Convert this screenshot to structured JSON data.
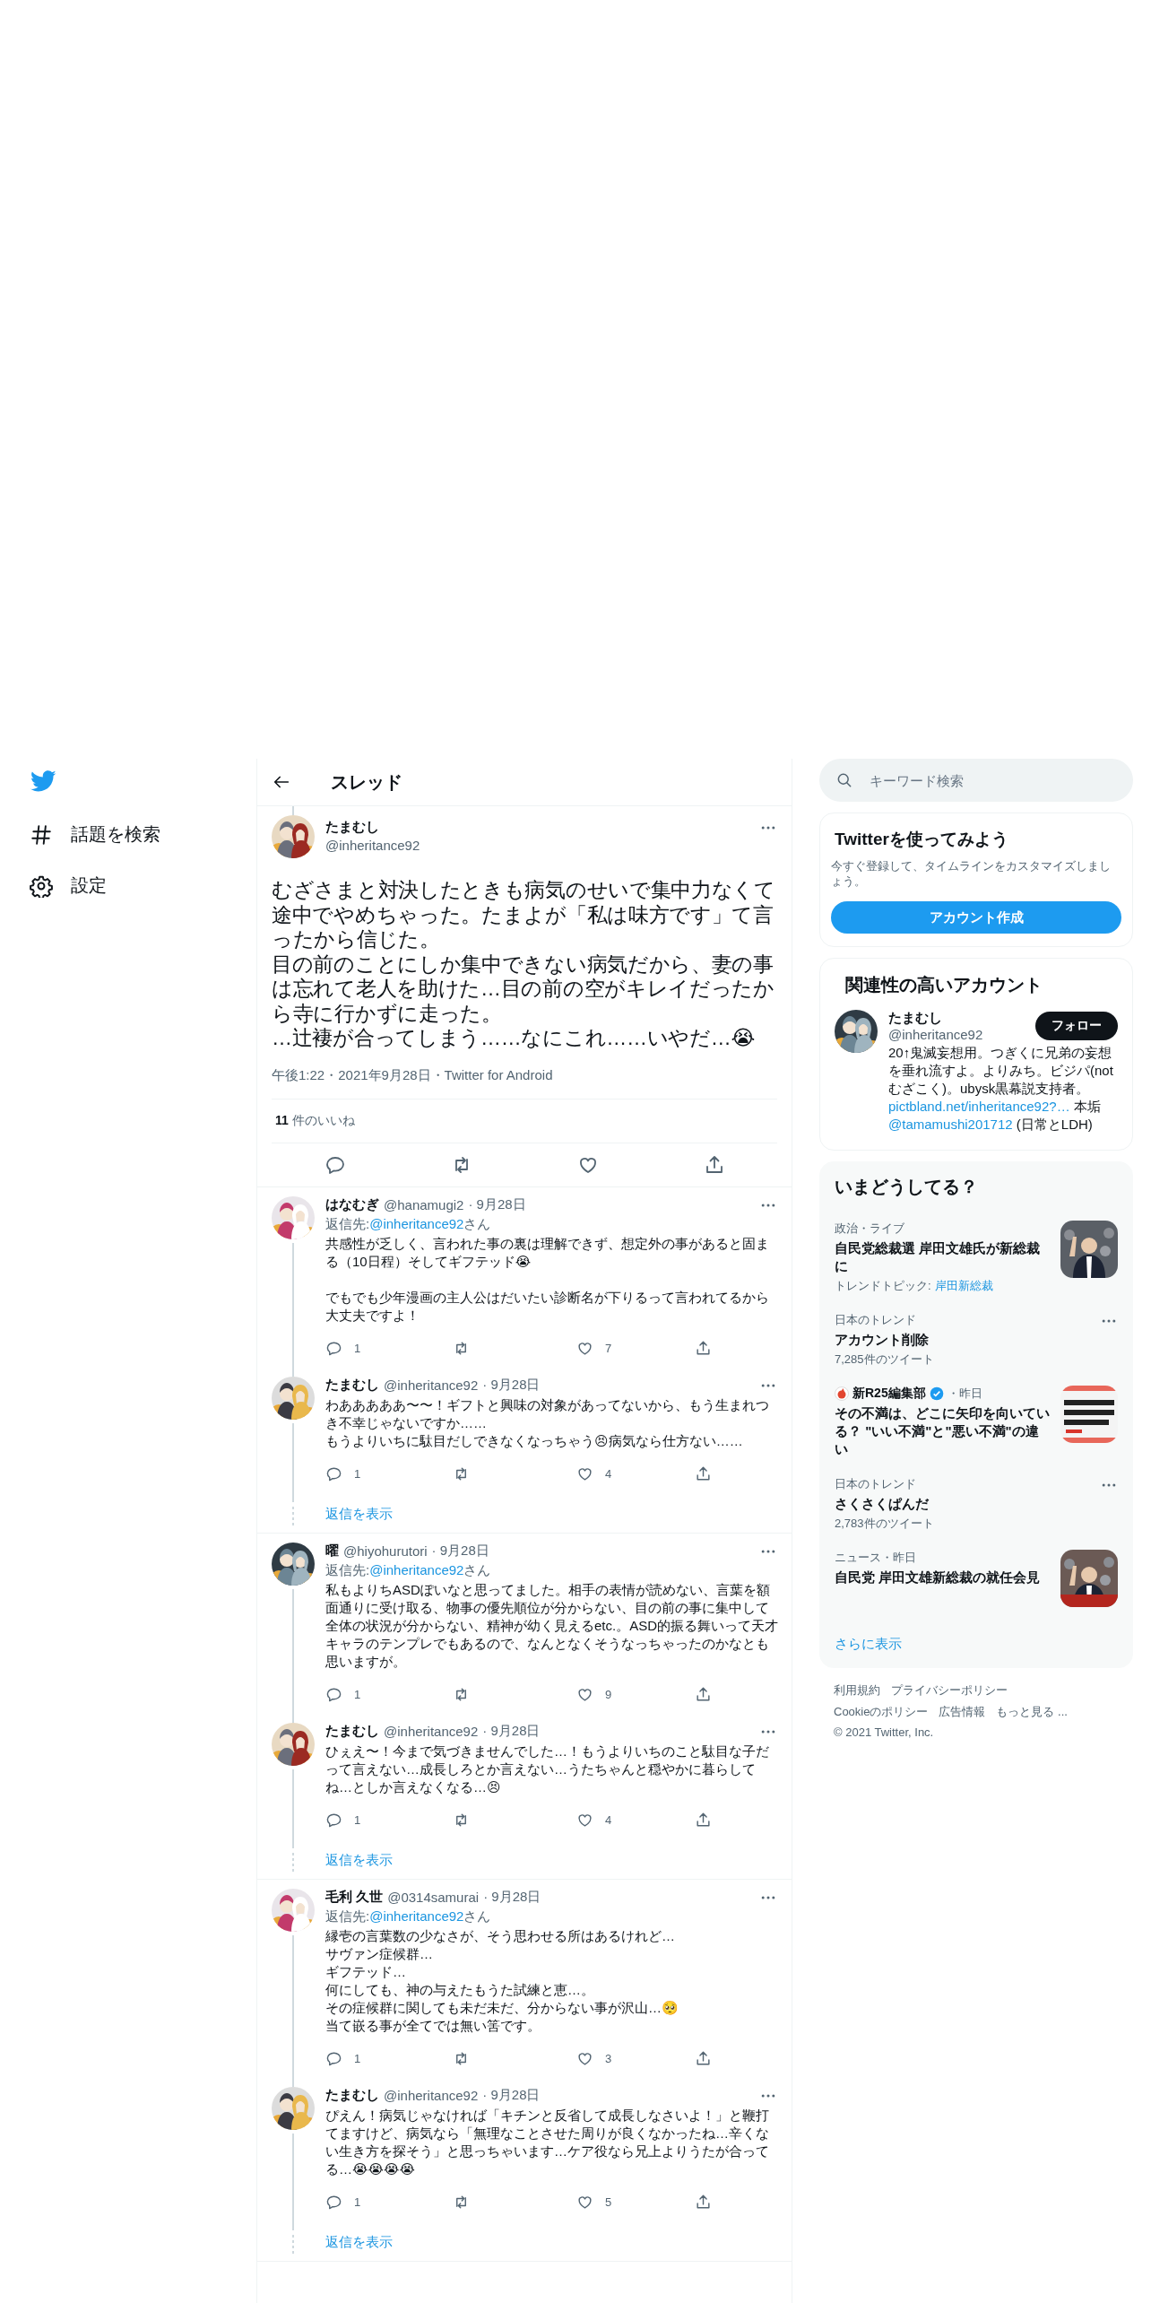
{
  "sidebar": {
    "items": [
      {
        "kind": "explore",
        "label": "話題を検索"
      },
      {
        "kind": "settings",
        "label": "設定"
      }
    ]
  },
  "header": {
    "title": "スレッド"
  },
  "main_tweet": {
    "name": "たまむし",
    "handle": "@inheritance92",
    "avatar": {
      "kind": "picture"
    },
    "body": [
      {
        "parts": [
          {
            "text": "むざさまと対決したときも病気のせいで集中力なくて途中でやめちゃった。たまよが「私は味方です」て言ったから信じた。"
          }
        ]
      },
      {
        "parts": [
          {
            "text": "目の前のことにしか集中できない病気だから、妻の事は忘れて老人を助けた…目の前の空がキレイだったから寺に行かずに走った。"
          }
        ]
      },
      {
        "parts": [
          {
            "text": "…辻褄が合ってしまう……なにこれ……いやだ…😭"
          }
        ]
      }
    ],
    "meta": "午後1:22・2021年9月28日・Twitter for Android",
    "likes": "**11** 件のいいね"
  },
  "threads": [
    {
      "show_replies": "返信を表示",
      "tweets": [
        {
          "name": "はなむぎ",
          "handle": "@hanamugi2",
          "date": "· 9月28日",
          "avatar": {
            "kind": "picture"
          },
          "reply_to": {
            "label": "返信先:",
            "user": "@inheritance92",
            "suffix": "さん"
          },
          "body": [
            {
              "parts": [
                {
                  "text": "共感性が乏しく、言われた事の裏は理解できず、想定外の事があると固まる（10日程）そしてギフテッド😭"
                }
              ]
            },
            {
              "blank_before": true,
              "parts": [
                {
                  "text": "でもでも少年漫画の主人公はだいたい診断名が下りるって言われてるから大丈夫ですよ！"
                }
              ]
            }
          ],
          "replies": "1",
          "likes": "7"
        },
        {
          "name": "たまむし",
          "handle": "@inheritance92",
          "date": "· 9月28日",
          "avatar": {
            "kind": "picture"
          },
          "body": [
            {
              "parts": [
                {
                  "text": "わあああああ〜〜！ギフトと興味の対象があってないから、もう生まれつき不幸じゃないですか……"
                }
              ]
            },
            {
              "parts": [
                {
                  "text": "もうよりいちに駄目だしできなくなっちゃう😣病気なら仕方ない……"
                }
              ]
            }
          ],
          "replies": "1",
          "likes": "4"
        }
      ]
    },
    {
      "show_replies": "返信を表示",
      "tweets": [
        {
          "name": "曜",
          "handle": "@hiyohurutori",
          "date": "· 9月28日",
          "avatar": {
            "kind": "picture"
          },
          "reply_to": {
            "label": "返信先:",
            "user": "@inheritance92",
            "suffix": "さん"
          },
          "body": [
            {
              "parts": [
                {
                  "text": "私もよりちASDぽいなと思ってました。相手の表情が読めない、言葉を額面通りに受け取る、物事の優先順位が分からない、目の前の事に集中して全体の状況が分からない、精神が幼く見えるetc.。ASD的振る舞いって天才キャラのテンプレでもあるので、なんとなくそうなっちゃったのかなとも思いますが。"
                }
              ]
            }
          ],
          "replies": "1",
          "likes": "9"
        },
        {
          "name": "たまむし",
          "handle": "@inheritance92",
          "date": "· 9月28日",
          "avatar": {
            "kind": "picture"
          },
          "body": [
            {
              "parts": [
                {
                  "text": "ひぇえ〜！今まで気づきませんでした…！もうよりいちのこと駄目な子だって言えない…成長しろとか言えない…うたちゃんと穏やかに暮らしてね…としか言えなくなる…😣"
                }
              ]
            }
          ],
          "replies": "1",
          "likes": "4"
        }
      ]
    },
    {
      "show_replies": "返信を表示",
      "tweets": [
        {
          "name": "毛利 久世",
          "handle": "@0314samurai",
          "date": "· 9月28日",
          "avatar": {
            "kind": "picture"
          },
          "reply_to": {
            "label": "返信先:",
            "user": "@inheritance92",
            "suffix": "さん"
          },
          "body": [
            {
              "parts": [
                {
                  "text": "縁壱の言葉数の少なさが、そう思わせる所はあるけれど…"
                }
              ]
            },
            {
              "parts": [
                {
                  "text": "サヴァン症候群…"
                }
              ]
            },
            {
              "parts": [
                {
                  "text": "ギフテッド…"
                }
              ]
            },
            {
              "parts": [
                {
                  "text": "何にしても、神の与えたもうた試練と恵…。"
                }
              ]
            },
            {
              "parts": [
                {
                  "text": "その症候群に関しても未だ未だ、分からない事が沢山…🥺"
                }
              ]
            },
            {
              "parts": [
                {
                  "text": "当て嵌る事が全てでは無い筈です。"
                }
              ]
            }
          ],
          "replies": "1",
          "likes": "3"
        },
        {
          "name": "たまむし",
          "handle": "@inheritance92",
          "date": "· 9月28日",
          "avatar": {
            "kind": "picture"
          },
          "body": [
            {
              "parts": [
                {
                  "text": "ぴえん！病気じゃなければ「キチンと反省して成長しなさいよ！」と鞭打てますけど、病気なら「無理なことさせた周りが良くなかったね…辛くない生き方を探そう」と思っちゃいます…ケア役なら兄上よりうたが合ってる…😭😭😭😭"
                }
              ]
            }
          ],
          "replies": "1",
          "likes": "5"
        }
      ]
    }
  ],
  "search": {
    "placeholder": "キーワード検索"
  },
  "signup": {
    "title": "Twitterを使ってみよう",
    "description": "今すぐ登録して、タイムラインをカスタマイズしましょう。",
    "button": "アカウント作成"
  },
  "relevant": {
    "title": "関連性の高いアカウント",
    "account": {
      "name": "たまむし",
      "handle": "@inheritance92",
      "avatar": {
        "kind": "picture"
      },
      "follow": "フォロー",
      "bio": [
        {
          "text": "20↑鬼滅妄想用。つぎくに兄弟の妄想を垂れ流すよ。よりみち。ビジパ(notむざこく)。ubysk黒幕説支持者。 "
        },
        {
          "text": "pictbland.net/inheritance92?…",
          "link": true
        },
        {
          "text": " 本垢 "
        },
        {
          "text": "@tamamushi201712",
          "link": true
        },
        {
          "text": " (日常とLDH)"
        }
      ]
    }
  },
  "trends": {
    "title": "いまどうしてる？",
    "items": [
      {
        "kind": "topic",
        "category": "政治・ライブ",
        "title": "自民党総裁選 岸田文雄氏が新総裁に",
        "topic_label": "トレンドトピック:",
        "topic": "岸田新総裁",
        "image": {
          "kind": "picture"
        }
      },
      {
        "kind": "trend",
        "category": "日本のトレンド",
        "title": "アカウント削除",
        "count": "7,285件のツイート"
      },
      {
        "kind": "article",
        "source": "新R25編集部",
        "verified": true,
        "time": "・昨日",
        "title": "その不満は、どこに矢印を向いている？ \"いい不満\"と\"悪い不満\"の違い",
        "image": {
          "kind": "picture"
        }
      },
      {
        "kind": "trend",
        "category": "日本のトレンド",
        "title": "さくさくぱんだ",
        "count": "2,783件のツイート"
      },
      {
        "kind": "topic",
        "category": "ニュース・昨日",
        "title": "自民党 岸田文雄新総裁の就任会見",
        "image": {
          "kind": "picture"
        }
      }
    ],
    "more": "さらに表示"
  },
  "footer": {
    "links": [
      [
        "利用規約",
        "プライバシーポリシー"
      ],
      [
        "Cookieのポリシー",
        "広告情報",
        "もっと見る ..."
      ]
    ],
    "copyright": "© 2021 Twitter, Inc."
  }
}
